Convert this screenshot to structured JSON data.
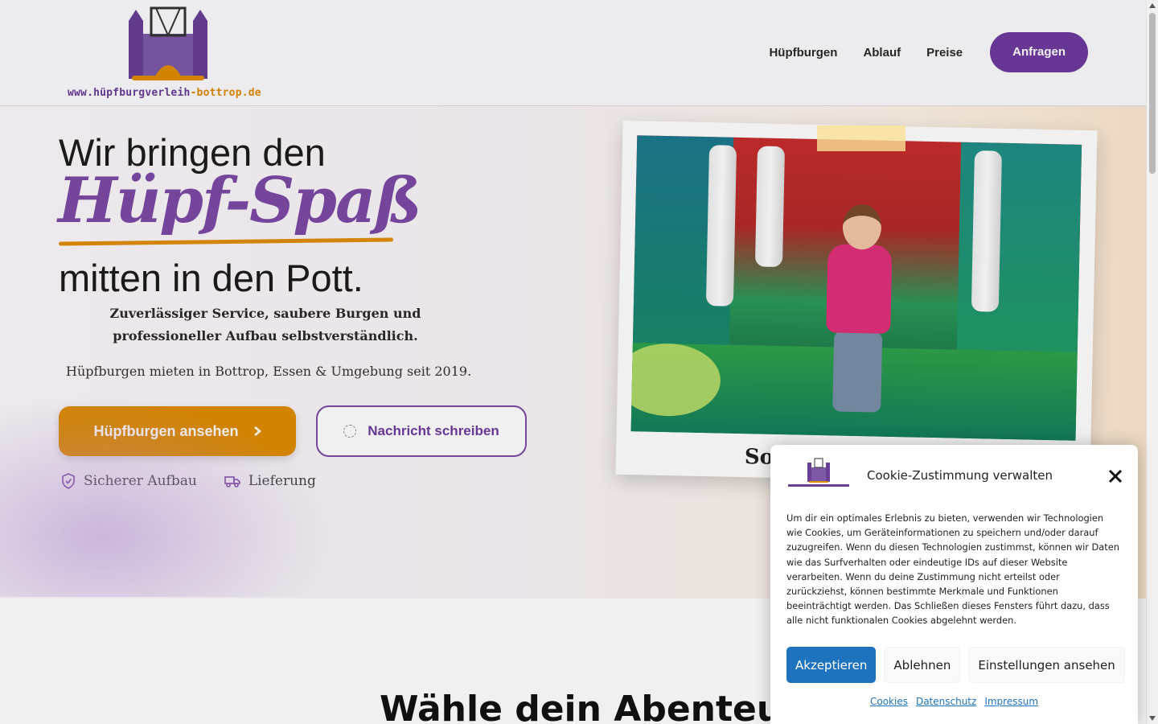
{
  "header": {
    "logo_text_main": "www.hüpfburgverleih",
    "logo_text_accent": "-bottrop.de",
    "nav": [
      "Hüpfburgen",
      "Ablauf",
      "Preise"
    ],
    "cta": "Anfragen"
  },
  "hero": {
    "line1": "Wir bringen den",
    "highlight": "Hüpf-Spaß",
    "line3": "mitten in den Pott.",
    "subtitle": "Zuverlässiger Service, saubere Burgen und professioneller Aufbau selbstverständlich.",
    "since": "Hüpfburgen mieten in Bottrop, Essen & Umgebung seit 2019.",
    "primary_button": "Hüpfburgen ansehen",
    "secondary_button": "Nachricht schreiben",
    "features": [
      "Sicherer Aufbau",
      "Lieferung"
    ],
    "polaroid_caption": "So"
  },
  "section": {
    "title": "Wähle dein Abenteuer"
  },
  "cookie": {
    "title": "Cookie-Zustimmung verwalten",
    "text": "Um dir ein optimales Erlebnis zu bieten, verwenden wir Technologien wie Cookies, um Geräteinformationen zu speichern und/oder darauf zuzugreifen. Wenn du diesen Technologien zustimmst, können wir Daten wie das Surfverhalten oder eindeutige IDs auf dieser Website verarbeiten. Wenn du deine Zustimmung nicht erteilst oder zurückziehst, können bestimmte Merkmale und Funktionen beeinträchtigt werden. Das Schließen dieses Fensters führt dazu, dass alle nicht funktionalen Cookies abgelehnt werden.",
    "accept": "Akzeptieren",
    "deny": "Ablehnen",
    "preferences": "Einstellungen ansehen",
    "links": [
      "Cookies",
      "Datenschutz",
      "Impressum"
    ]
  },
  "colors": {
    "brand_purple": "#6f3b9f",
    "brand_orange": "#e08c00",
    "accept_blue": "#1e73be"
  }
}
